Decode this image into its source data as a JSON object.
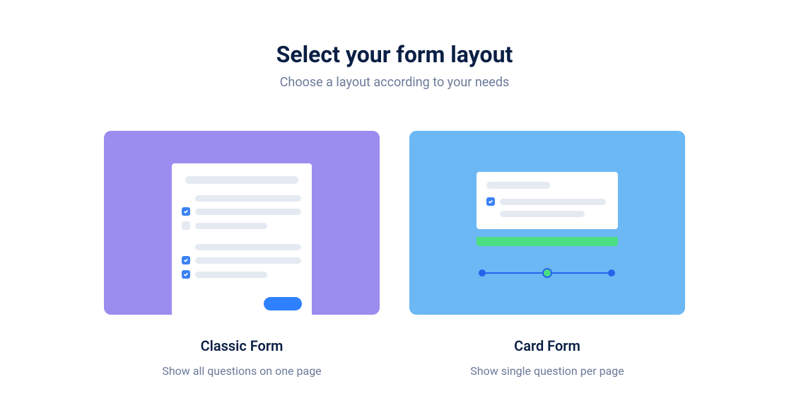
{
  "header": {
    "title": "Select your form layout",
    "subtitle": "Choose a layout according to your needs"
  },
  "options": {
    "classic": {
      "title": "Classic Form",
      "description": "Show all questions on one page"
    },
    "card": {
      "title": "Card Form",
      "description": "Show single question per page"
    }
  },
  "colors": {
    "classic_bg": "#9b8cf0",
    "card_bg": "#6bb8f5",
    "accent_blue": "#2f80ff",
    "accent_green": "#4ade80"
  }
}
